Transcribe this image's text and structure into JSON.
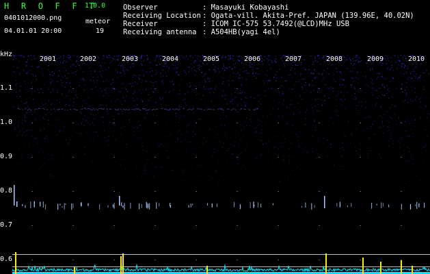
{
  "app": {
    "logo": "H R O F F T",
    "version": "1.0.0"
  },
  "left_info": {
    "filename": "0401012000.png",
    "meteor_label": "meteor",
    "datetime": "04.01.01 20:00",
    "meteor_count": "19"
  },
  "station": [
    {
      "label": "Observer",
      "value": ": Masayuki Kobayashi"
    },
    {
      "label": "Receiving Location",
      "value": ": Ogata-vill. Akita-Pref. JAPAN (139.96E, 40.02N)"
    },
    {
      "label": "Receiver",
      "value": ": ICOM IC-575 53.7492(@LCD)MHz USB"
    },
    {
      "label": "Receiving antenna",
      "value": ": A504HB(yagi 4el)"
    }
  ],
  "axis": {
    "unit": "kHz",
    "yticks": [
      "1.1",
      "1.0",
      "0.9",
      "0.8",
      "0.7",
      "0.6"
    ],
    "years": [
      "2001",
      "2002",
      "2003",
      "2004",
      "2005",
      "2006",
      "2007",
      "2008",
      "2009",
      "2010"
    ]
  },
  "colors": {
    "background": "#000000",
    "logo": "#33ff33",
    "text": "#ffffff",
    "noise": "#3a3aff",
    "echo": "#aaccff",
    "baseline": "#00e5ff",
    "peak": "#ffee00"
  }
}
